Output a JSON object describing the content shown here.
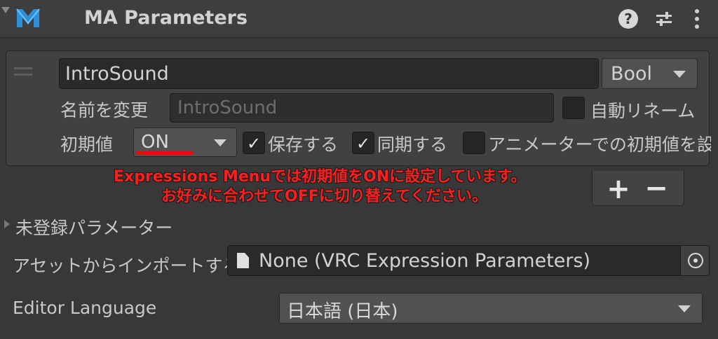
{
  "header": {
    "title": "MA Parameters",
    "logo_icon": "modular-avatar-logo",
    "help_icon_label": "?",
    "icons": [
      "help-icon",
      "preset-icon",
      "kebab-menu-icon"
    ]
  },
  "parameter": {
    "name": "IntroSound",
    "type": "Bool",
    "rename_label": "名前を変更",
    "rename_placeholder": "IntroSound",
    "auto_rename_label": "自動リネーム",
    "auto_rename_checked": false,
    "initial_label": "初期値",
    "initial_value": "ON",
    "save_label": "保存する",
    "save_checked": true,
    "sync_label": "同期する",
    "sync_checked": true,
    "anim_label": "アニメーターでの初期値を設",
    "anim_checked": false,
    "checkmark": "✓"
  },
  "annotation": {
    "line1": "Expressions Menuでは初期値をONに設定しています。",
    "line2": "お好みに合わせてOFFに切り替えてください。",
    "color": "#ff1e1e"
  },
  "list_controls": {
    "add_label": "+",
    "remove_label": "−"
  },
  "unregistered": {
    "label": "未登録パラメーター"
  },
  "import": {
    "label": "アセットからインポートする",
    "value": "None (VRC Expression Parameters)"
  },
  "language": {
    "label": "Editor Language",
    "value": "日本語 (日本)"
  }
}
